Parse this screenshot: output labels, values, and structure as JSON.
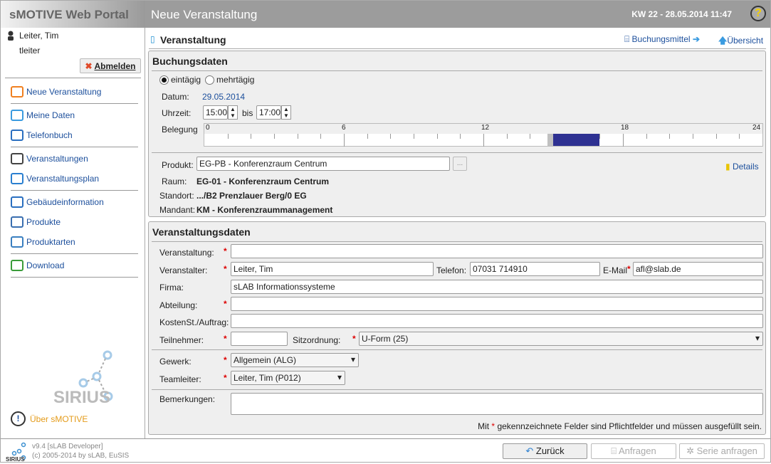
{
  "header": {
    "app_title": "sMOTIVE Web Portal",
    "page_title": "Neue Veranstaltung",
    "date": "KW 22 - 28.05.2014 11:47",
    "help_icon": "help-icon"
  },
  "user": {
    "name": "Leiter, Tim",
    "login": "tleiter",
    "logout": "Abmelden"
  },
  "sidebar": {
    "items": [
      {
        "label": "Neue Veranstaltung",
        "icon": "new-event-icon"
      },
      {
        "label": "Meine Daten",
        "icon": "user-icon"
      },
      {
        "label": "Telefonbuch",
        "icon": "phonebook-icon"
      },
      {
        "label": "Veranstaltungen",
        "icon": "presentation-icon"
      },
      {
        "label": "Veranstaltungsplan",
        "icon": "plan-icon"
      },
      {
        "label": "Gebäudeinformation",
        "icon": "building-icon"
      },
      {
        "label": "Produkte",
        "icon": "products-icon"
      },
      {
        "label": "Produktarten",
        "icon": "product-types-icon"
      },
      {
        "label": "Download",
        "icon": "download-icon"
      }
    ],
    "logo": "SIRIUS",
    "about": "Über sMOTIVE"
  },
  "main": {
    "title": "Veranstaltung",
    "link_buchungsmittel": "Buchungsmittel",
    "link_uebersicht": "Übersicht"
  },
  "buchung": {
    "title": "Buchungsdaten",
    "radio_single": "eintägig",
    "radio_multi": "mehrtägig",
    "selected": "eintägig",
    "datum_label": "Datum:",
    "datum": "29.05.2014",
    "uhrzeit_label": "Uhrzeit:",
    "from": "15:00",
    "bis": "bis",
    "to": "17:00",
    "belegung_label": "Belegung",
    "axis_ticks": [
      "0",
      "6",
      "12",
      "18",
      "24"
    ],
    "occupancy": {
      "range_hours": [
        0,
        24
      ],
      "buffer": [
        14.75,
        15
      ],
      "booked": [
        15,
        17
      ],
      "booked_color": "#2e3192",
      "buffer_color": "#c0c0c0"
    },
    "produkt_label": "Produkt:",
    "produkt": "EG-PB - Konferenzraum Centrum",
    "browse": "...",
    "details": "Details",
    "raum_label": "Raum:",
    "raum": "EG-01 - Konferenzraum Centrum",
    "standort_label": "Standort:",
    "standort": ".../B2 Prenzlauer Berg/0 EG",
    "mandant_label": "Mandant:",
    "mandant": "KM - Konferenzraummanagement"
  },
  "vdaten": {
    "title": "Veranstaltungsdaten",
    "veranstaltung_label": "Veranstaltung:",
    "veranstaltung": "",
    "veranstalter_label": "Veranstalter:",
    "veranstalter": "Leiter, Tim",
    "telefon_label": "Telefon:",
    "telefon": "07031 714910",
    "email_label": "E-Mail",
    "email": "afl@slab.de",
    "firma_label": "Firma:",
    "firma": "sLAB Informationssysteme",
    "abteilung_label": "Abteilung:",
    "abteilung": "",
    "kosten_label": "KostenSt./Auftrag:",
    "kosten": "",
    "teilnehmer_label": "Teilnehmer:",
    "teilnehmer": "",
    "sitz_label": "Sitzordnung:",
    "sitz": "U-Form (25)",
    "gewerk_label": "Gewerk:",
    "gewerk": "Allgemein (ALG)",
    "teamleiter_label": "Teamleiter:",
    "teamleiter": "Leiter, Tim (P012)",
    "bem_label": "Bemerkungen:",
    "bem": "",
    "note_pre": "Mit",
    "note_star": "*",
    "note_post": "gekennzeichnete Felder sind Pflichtfelder und müssen ausgefüllt sein.",
    "star": "*"
  },
  "footer": {
    "version": "v9.4 [sLAB Developer]",
    "copyright": "(c) 2005-2014 by sLAB, EuSIS",
    "back": "Zurück",
    "request": "Anfragen",
    "series": "Serie anfragen"
  }
}
